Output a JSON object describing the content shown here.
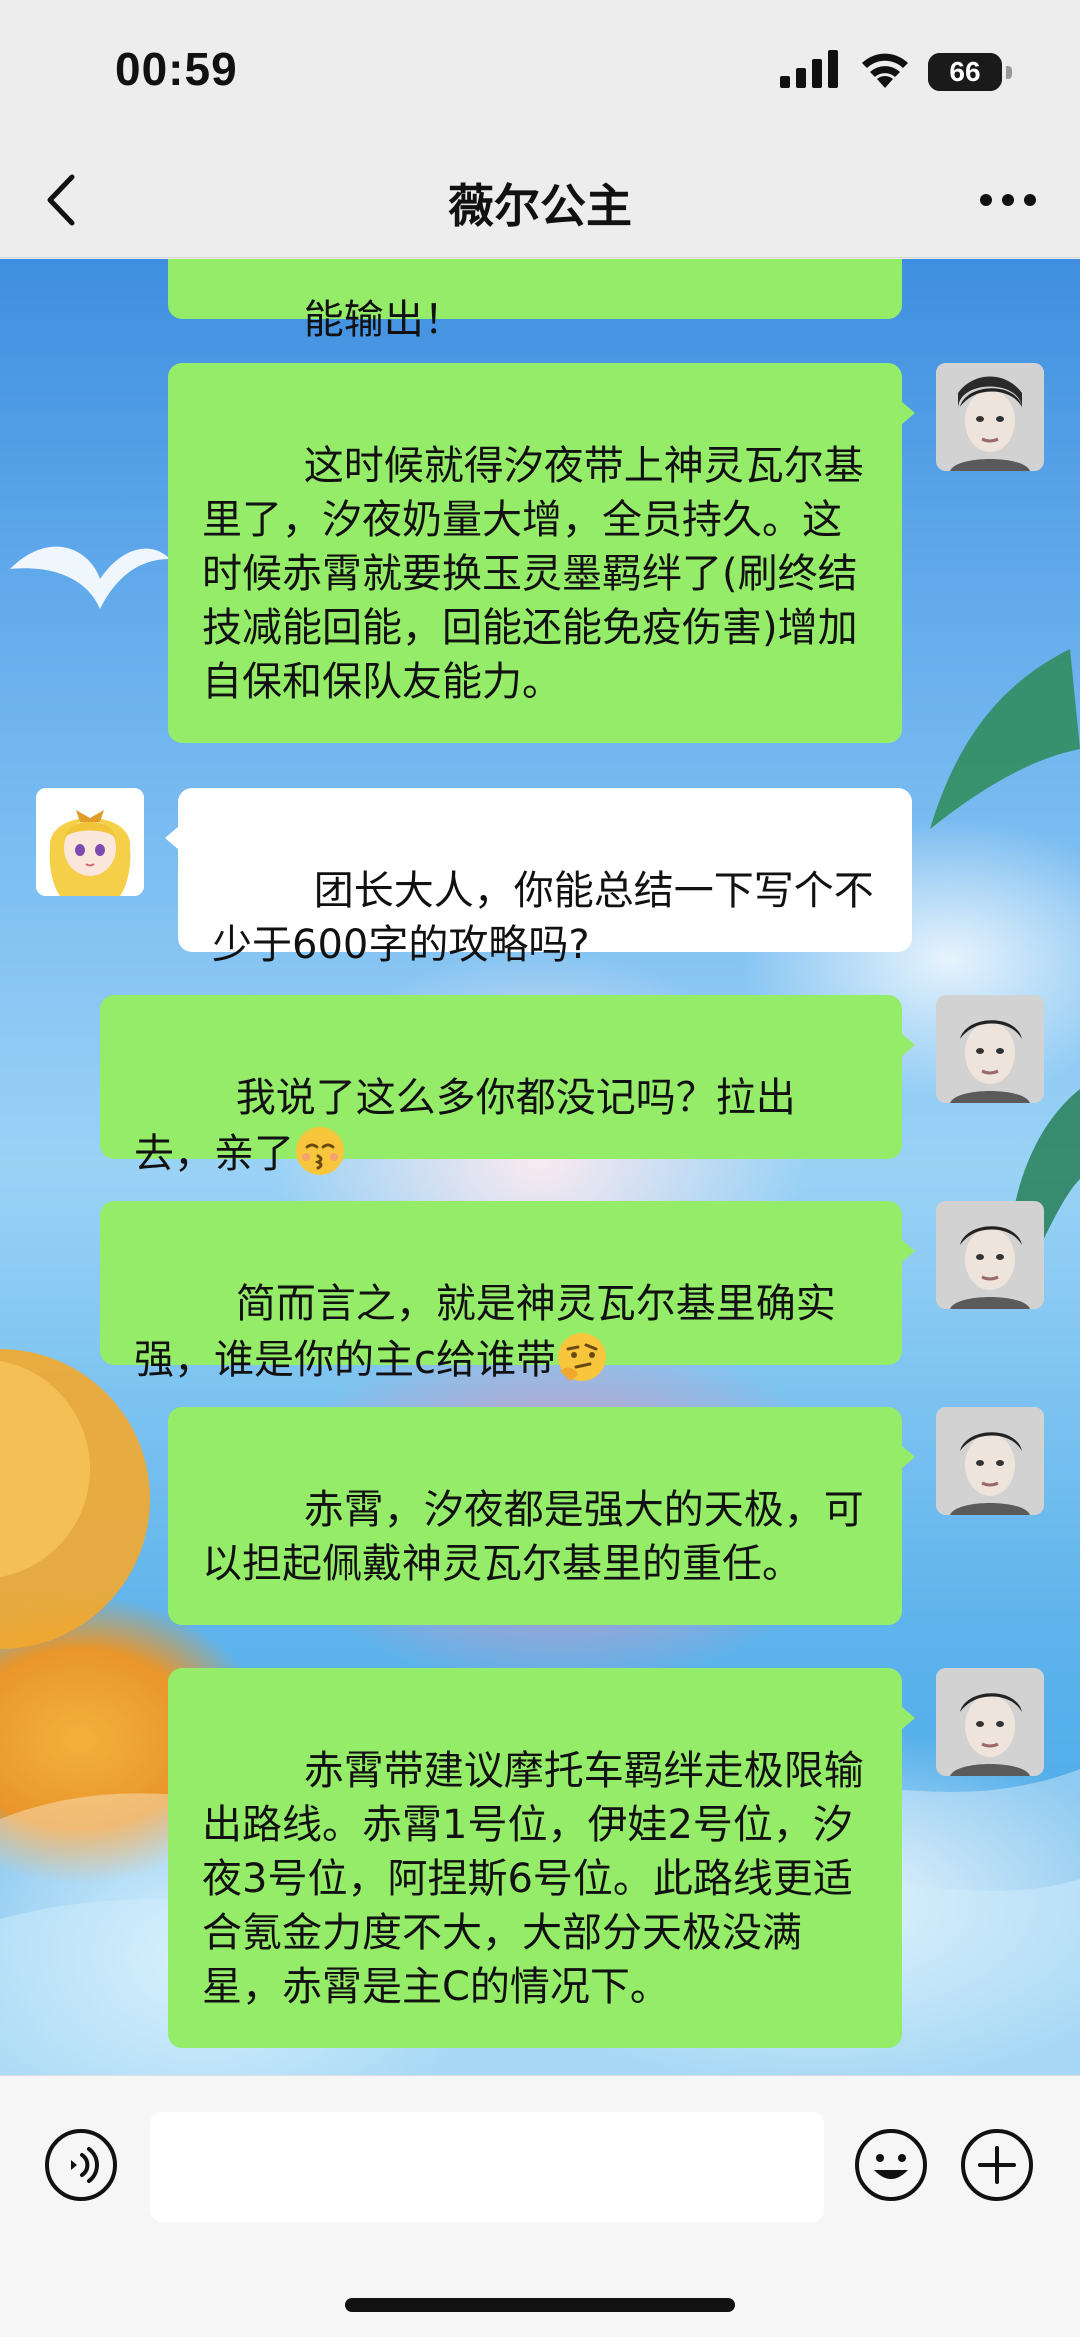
{
  "status": {
    "time": "00:59",
    "battery": "66"
  },
  "nav": {
    "title": "薇尔公主"
  },
  "messages": [
    {
      "side": "me",
      "text": "能输出！"
    },
    {
      "side": "me",
      "text": "这时候就得汐夜带上神灵瓦尔基里了，汐夜奶量大增，全员持久。这时候赤霄就要换玉灵墨羁绊了(刷终结技减能回能，回能还能免疫伤害)增加自保和保队友能力。"
    },
    {
      "side": "other",
      "text": "团长大人，你能总结一下写个不少于600字的攻略吗?"
    },
    {
      "side": "me",
      "text": "我说了这么多你都没记吗？拉出去，亲了",
      "emoji": "kissing-face"
    },
    {
      "side": "me",
      "text": "简而言之，就是神灵瓦尔基里确实强，谁是你的主c给谁带",
      "emoji": "thinking-face"
    },
    {
      "side": "me",
      "text": "赤霄，汐夜都是强大的天极，可以担起佩戴神灵瓦尔基里的重任。"
    },
    {
      "side": "me",
      "text": "赤霄带建议摩托车羁绊走极限输出路线。赤霄1号位，伊娃2号位，汐夜3号位，阿捏斯6号位。此路线更适合氪金力度不大，大部分天极没满星，赤霄是主C的情况下。"
    }
  ],
  "colors": {
    "my_bubble": "#95ec69",
    "other_bubble": "#ffffff",
    "bar": "#ededed"
  }
}
